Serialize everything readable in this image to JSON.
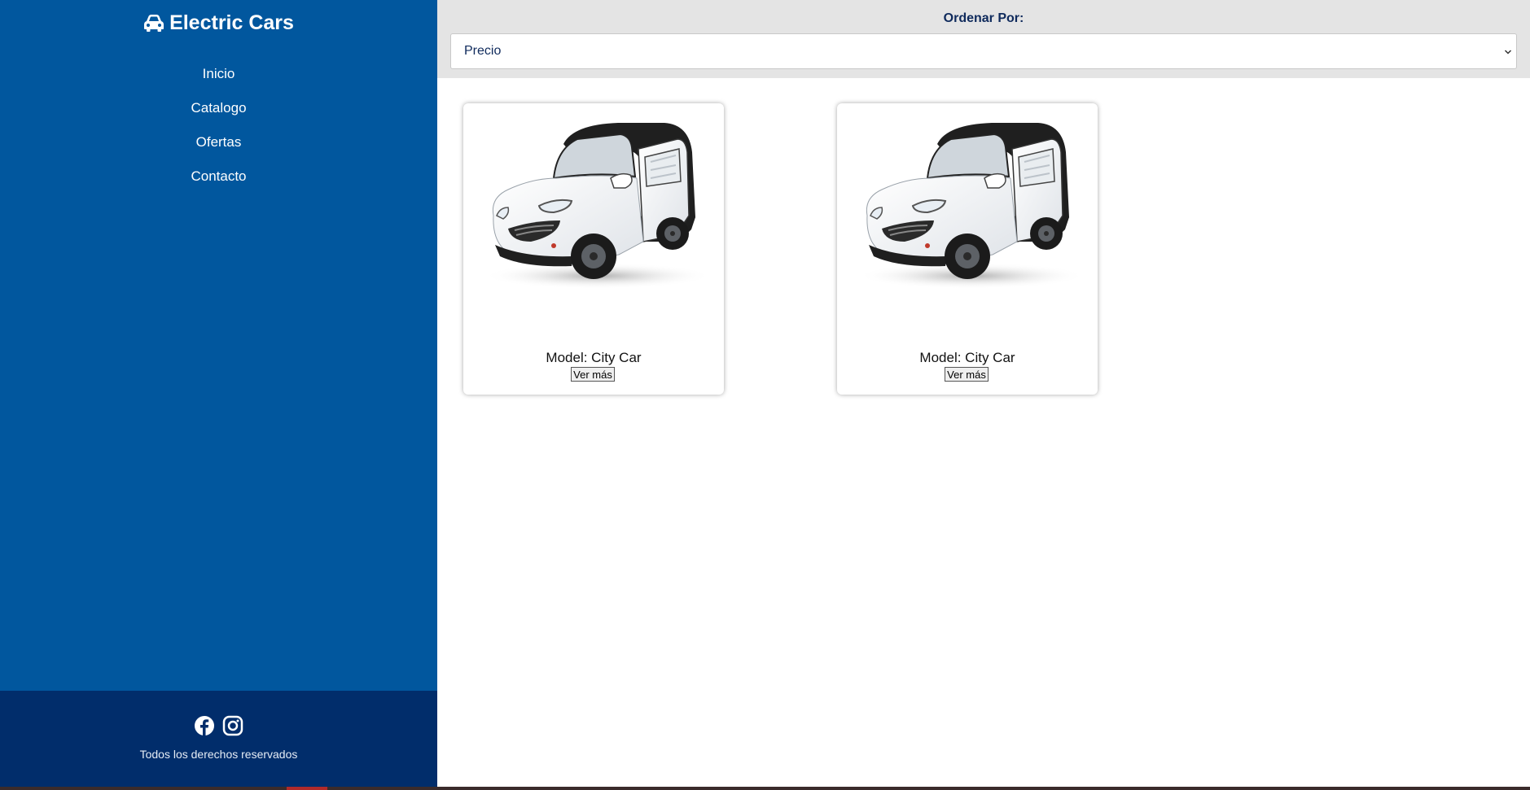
{
  "sidebar": {
    "brand": "Electric Cars",
    "brand_icon": "car-icon",
    "nav": [
      "Inicio",
      "Catalogo",
      "Ofertas",
      "Contacto"
    ],
    "footer": {
      "social_icons": [
        "facebook-icon",
        "instagram-icon"
      ],
      "copyright": "Todos los derechos reservados"
    },
    "colors": {
      "sidebar_bg": "#01579e",
      "footer_bg": "#012d6b"
    }
  },
  "sort": {
    "label": "Ordenar Por:",
    "selected": "Precio"
  },
  "products": [
    {
      "model": "Model: City Car",
      "button": "Ver más"
    },
    {
      "model": "Model: City Car",
      "button": "Ver más"
    }
  ]
}
